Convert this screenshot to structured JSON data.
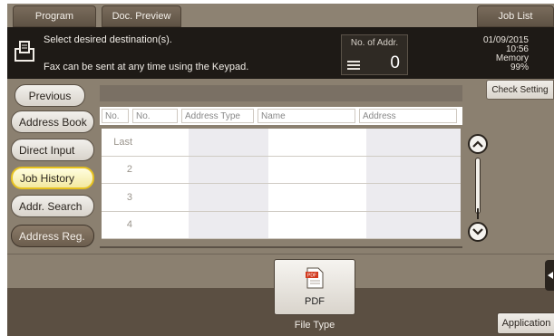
{
  "tabs": {
    "program": "Program",
    "doc_preview": "Doc. Preview",
    "job_list": "Job List"
  },
  "message": {
    "line1": "Select desired destination(s).",
    "line2": "Fax can be sent at any time using the Keypad."
  },
  "addresses": {
    "label": "No. of Addr.",
    "count": "0"
  },
  "status": {
    "date": "01/09/2015",
    "time": "10:56",
    "memory_label": "Memory",
    "memory_value": "99%"
  },
  "side_nav": {
    "previous": "Previous",
    "address_book": "Address Book",
    "direct_input": "Direct Input",
    "job_history": "Job History",
    "addr_search": "Addr. Search",
    "address_reg": "Address Reg."
  },
  "check_setting": "Check Setting",
  "table": {
    "headers": [
      "No.",
      "No.",
      "Address Type",
      "Name",
      "Address"
    ],
    "rows": [
      {
        "no": "Last"
      },
      {
        "no": "2"
      },
      {
        "no": "3"
      },
      {
        "no": "4"
      }
    ]
  },
  "file_type": {
    "button_label": "PDF",
    "caption": "File Type"
  },
  "application": "Application",
  "icons": {
    "destination": "fax-document-icon",
    "list": "list-icon",
    "pdf": "pdf-file-icon",
    "scroll_up": "chevron-up-icon",
    "scroll_down": "chevron-down-icon"
  },
  "colors": {
    "selected_accent": "#e7c21f",
    "header_background": "#1e1a16",
    "frame_background": "#8b8070"
  }
}
